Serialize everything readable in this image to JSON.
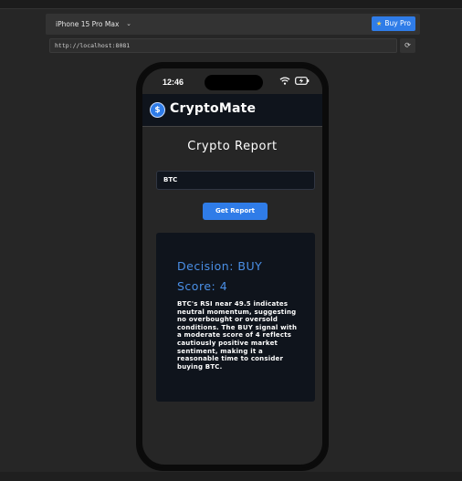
{
  "browser": {
    "device": "iPhone 15 Pro Max",
    "buy_pro_label": "Buy Pro",
    "url": "http://localhost:8081"
  },
  "status_bar": {
    "time": "12:46"
  },
  "app": {
    "name": "CryptoMate",
    "logo_glyph": "$"
  },
  "page": {
    "title": "Crypto Report",
    "ticker_value": "BTC",
    "button_label": "Get Report"
  },
  "report": {
    "decision": "Decision: BUY",
    "score": "Score: 4",
    "reasoning": "BTC's RSI near 49.5 indicates neutral momentum, suggesting no overbought or oversold conditions. The BUY signal with a moderate score of 4 reflects cautiously positive market sentiment, making it a reasonable time to consider buying BTC."
  },
  "colors": {
    "accent": "#2f7ce8",
    "decision_text": "#4a8fe6",
    "card_bg": "#0f141c",
    "page_bg": "#262626"
  }
}
